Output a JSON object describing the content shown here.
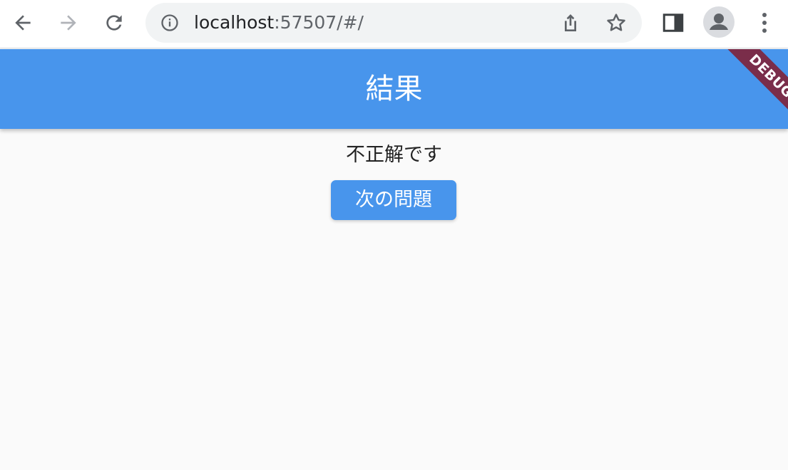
{
  "browser": {
    "url_host": "localhost",
    "url_rest": ":57507/#/",
    "icons": {
      "back": "back-arrow-icon",
      "forward": "forward-arrow-icon",
      "reload": "reload-icon",
      "info": "info-icon",
      "share": "share-icon",
      "bookmark": "star-icon",
      "side_panel": "side-panel-icon",
      "profile": "profile-icon",
      "menu": "kebab-menu-icon"
    }
  },
  "app": {
    "title": "結果",
    "debug_banner": "DEBUG",
    "result_text": "不正解です",
    "next_button_label": "次の問題",
    "colors": {
      "primary": "#4895ec",
      "debug_banner": "#7a2d4a",
      "background": "#fafafa"
    }
  }
}
